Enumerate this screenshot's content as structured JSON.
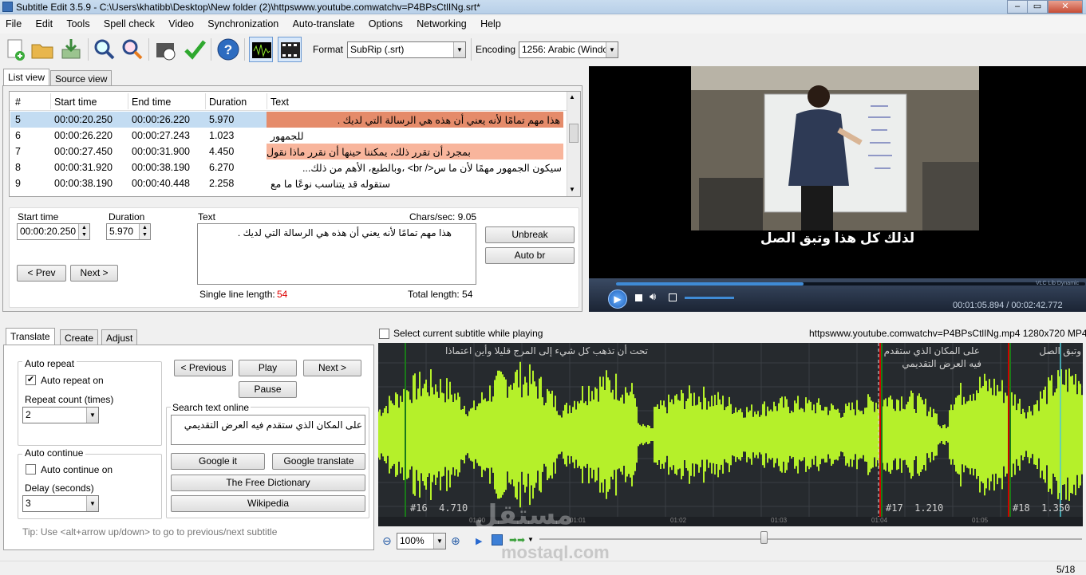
{
  "window": {
    "title": "Subtitle Edit 3.5.9 - C:\\Users\\khatibb\\Desktop\\New folder (2)\\httpswww.youtube.comwatchv=P4BPsCtlINg.srt*",
    "min": "–",
    "max": "▭",
    "close": "✕"
  },
  "menu": [
    "File",
    "Edit",
    "Tools",
    "Spell check",
    "Video",
    "Synchronization",
    "Auto-translate",
    "Options",
    "Networking",
    "Help"
  ],
  "toolbar": {
    "format_label": "Format",
    "format_value": "SubRip (.srt)",
    "encoding_label": "Encoding",
    "encoding_value": "1256: Arabic (Windows)",
    "help_glyph": "?"
  },
  "view_tabs": {
    "list": "List view",
    "source": "Source view"
  },
  "table": {
    "headers": [
      "#",
      "Start time",
      "End time",
      "Duration",
      "Text"
    ],
    "rows": [
      {
        "num": "5",
        "start": "00:00:20.250",
        "end": "00:00:26.220",
        "dur": "5.970",
        "text": "هذا مهم تمامًا لأنه يعني أن هذه هي الرسالة التي لديك ."
      },
      {
        "num": "6",
        "start": "00:00:26.220",
        "end": "00:00:27.243",
        "dur": "1.023",
        "text": "للجمهور"
      },
      {
        "num": "7",
        "start": "00:00:27.450",
        "end": "00:00:31.900",
        "dur": "4.450",
        "text": "بمجرد أن تقرر ذلك، يمكننا حينها أن نقرر ماذا نقول"
      },
      {
        "num": "8",
        "start": "00:00:31.920",
        "end": "00:00:38.190",
        "dur": "6.270",
        "text": "سيكون الجمهور مهمًا لأن ما س</ br> ،وبالطبع، الأهم من ذلك..."
      },
      {
        "num": "9",
        "start": "00:00:38.190",
        "end": "00:00:40.448",
        "dur": "2.258",
        "text": "ستقوله قد يتناسب نوعًا ما مع"
      }
    ]
  },
  "editor": {
    "start_label": "Start time",
    "duration_label": "Duration",
    "text_label": "Text",
    "chars_sec": "Chars/sec: 9.05",
    "start_value": "00:00:20.250",
    "duration_value": "5.970",
    "text_value": "هذا مهم تمامًا لأنه يعني أن هذه هي الرسالة التي لديك .",
    "prev": "< Prev",
    "next": "Next >",
    "unbreak": "Unbreak",
    "autobr": "Auto br",
    "single_line_label": "Single line length:",
    "single_line_value": "54",
    "total_length": "Total length: 54"
  },
  "video": {
    "subtitle": "لذلك كل هذا وتبق الصل",
    "time": "00:01:05.894 / 00:02:42.772",
    "lib": "VLC Lib Dynamic",
    "position_fraction": 0.4
  },
  "bottom_tabs": {
    "translate": "Translate",
    "create": "Create",
    "adjust": "Adjust"
  },
  "translate": {
    "auto_repeat_group": "Auto repeat",
    "auto_repeat_on": "Auto repeat on",
    "repeat_count_label": "Repeat count (times)",
    "repeat_count_value": "2",
    "auto_continue_group": "Auto continue",
    "auto_continue_on": "Auto continue on",
    "delay_label": "Delay (seconds)",
    "delay_value": "3",
    "previous": "< Previous",
    "play": "Play",
    "next": "Next >",
    "pause": "Pause",
    "search_label": "Search text online",
    "search_text": "على المكان الذي ستقدم فيه العرض التقديمي",
    "google_it": "Google it",
    "google_translate": "Google translate",
    "free_dictionary": "The Free Dictionary",
    "wikipedia": "Wikipedia",
    "tip": "Tip: Use <alt+arrow up/down> to go to previous/next subtitle"
  },
  "waveform": {
    "select_label": "Select current subtitle while playing",
    "file_info": "httpswww.youtube.comwatchv=P4BPsCtlINg.mp4 1280x720 MP4",
    "seg_texts": [
      "تحت أن تذهب كل شيء إلى المرج قليلا وأين اعتماذا",
      "على المكان الذي ستقدم",
      "فيه العرض التقديمي",
      "وتبق الصل"
    ],
    "seg_labels": [
      "#16  4.710",
      "#17  1.210",
      "#18  1.350"
    ],
    "ticks": [
      "01:00",
      "01:01",
      "01:02",
      "01:03",
      "01:04",
      "01:05"
    ],
    "zoom": "100%",
    "status": "5/18",
    "watermark": "mostaql.com",
    "watermark_ar": "مستقل"
  }
}
